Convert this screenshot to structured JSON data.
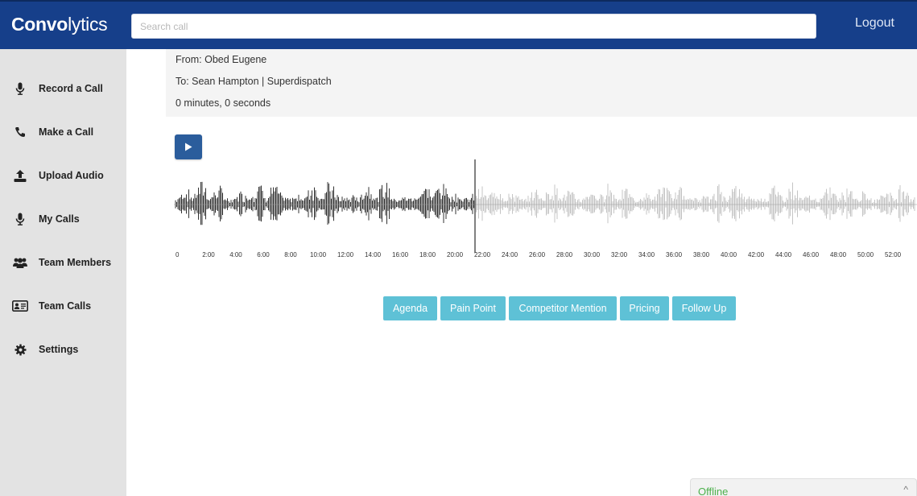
{
  "brand": {
    "bold": "Convo",
    "light": "lytics"
  },
  "search": {
    "placeholder": "Search call",
    "value": ""
  },
  "header": {
    "logout_label": "Logout"
  },
  "sidebar": {
    "items": [
      {
        "label": "Record a Call",
        "icon": "microphone-icon"
      },
      {
        "label": "Make a Call",
        "icon": "phone-icon"
      },
      {
        "label": "Upload Audio",
        "icon": "upload-icon"
      },
      {
        "label": "My Calls",
        "icon": "microphone-icon"
      },
      {
        "label": "Team Members",
        "icon": "users-icon"
      },
      {
        "label": "Team Calls",
        "icon": "id-card-icon"
      },
      {
        "label": "Settings",
        "icon": "gear-icon"
      }
    ]
  },
  "call": {
    "from": "From: Obed Eugene",
    "to": "To: Sean Hampton | Superdispatch",
    "duration": "0 minutes, 0 seconds"
  },
  "player": {
    "play_icon": "play-icon",
    "played_fraction": 0.405,
    "timeline_ticks": [
      "0",
      "2:00",
      "4:00",
      "6:00",
      "8:00",
      "10:00",
      "12:00",
      "14:00",
      "16:00",
      "18:00",
      "20:00",
      "22:00",
      "24:00",
      "26:00",
      "28:00",
      "30:00",
      "32:00",
      "34:00",
      "36:00",
      "38:00",
      "40:00",
      "42:00",
      "44:00",
      "46:00",
      "48:00",
      "50:00",
      "52:00"
    ]
  },
  "tags": [
    "Agenda",
    "Pain Point",
    "Competitor Mention",
    "Pricing",
    "Follow Up"
  ],
  "status": {
    "label": "Offline",
    "caret_icon": "chevron-up-icon"
  },
  "colors": {
    "header": "#163f8a",
    "sidebar": "#e3e3e3",
    "play_button": "#2b5d9c",
    "tag": "#5ec1d6",
    "wave_played": "#333333",
    "wave_unplayed": "#c4c4c4",
    "offline": "#4cb04c"
  }
}
